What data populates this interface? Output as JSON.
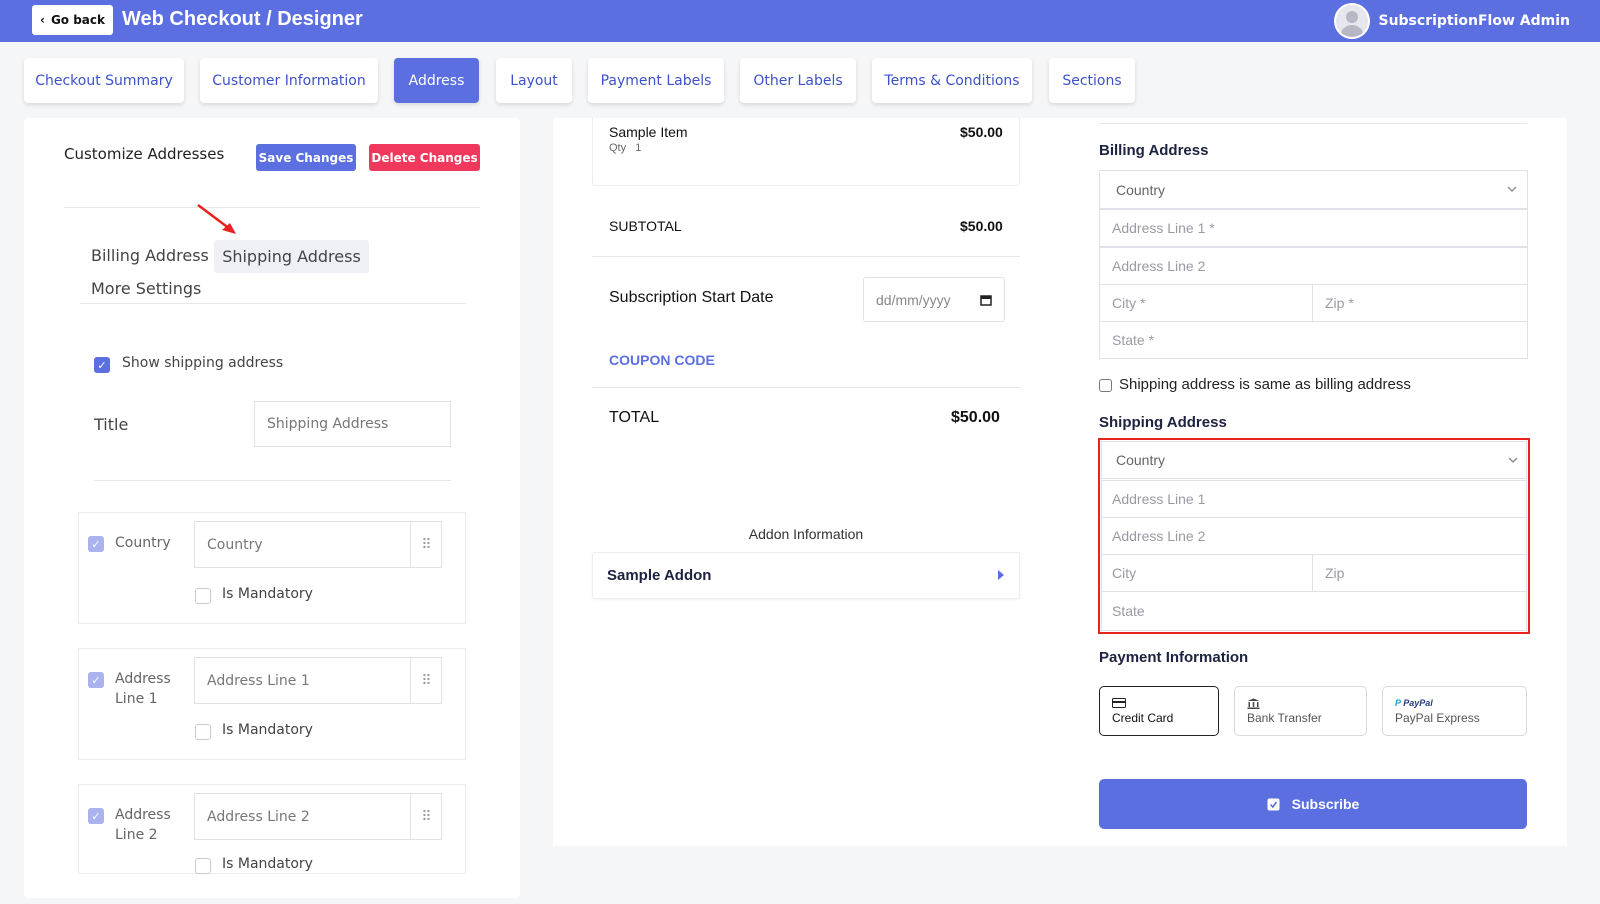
{
  "header": {
    "go_back": "Go back",
    "title": "Web Checkout / Designer",
    "user_name": "SubscriptionFlow Admin"
  },
  "tabs": [
    {
      "label": "Checkout Summary"
    },
    {
      "label": "Customer Information"
    },
    {
      "label": "Address"
    },
    {
      "label": "Layout"
    },
    {
      "label": "Payment Labels"
    },
    {
      "label": "Other Labels"
    },
    {
      "label": "Terms & Conditions"
    },
    {
      "label": "Sections"
    }
  ],
  "left": {
    "heading": "Customize Addresses",
    "save": "Save Changes",
    "delete": "Delete Changes",
    "subtabs": [
      "Billing Address",
      "Shipping Address",
      "More Settings"
    ],
    "show_shipping": "Show shipping address",
    "title_label": "Title",
    "title_value": "Shipping Address",
    "fields": [
      {
        "name": "Country",
        "value": "Country",
        "mandatory": "Is Mandatory"
      },
      {
        "name": "Address Line 1",
        "value": "Address Line 1",
        "mandatory": "Is Mandatory"
      },
      {
        "name": "Address Line 2",
        "value": "Address Line 2",
        "mandatory": "Is Mandatory"
      }
    ]
  },
  "mid": {
    "item_name": "Sample Item",
    "item_qty": "Qty   1",
    "item_price": "$50.00",
    "subtotal_label": "SUBTOTAL",
    "subtotal_value": "$50.00",
    "start_date_label": "Subscription Start Date",
    "date_placeholder": "dd/mm/yyyy",
    "coupon": "COUPON CODE",
    "total_label": "TOTAL",
    "total_value": "$50.00",
    "addon_info": "Addon Information",
    "addon_name": "Sample Addon"
  },
  "right": {
    "billing_title": "Billing Address",
    "billing": {
      "country": "Country",
      "line1": "Address Line 1 *",
      "line2": "Address Line 2",
      "city": "City *",
      "zip": "Zip *",
      "state": "State *"
    },
    "same_as": "Shipping address is same as billing address",
    "shipping_title": "Shipping Address",
    "shipping": {
      "country": "Country",
      "line1": "Address Line 1",
      "line2": "Address Line 2",
      "city": "City",
      "zip": "Zip",
      "state": "State"
    },
    "payment_title": "Payment Information",
    "payment_options": [
      "Credit Card",
      "Bank Transfer",
      "PayPal Express"
    ],
    "paypal_logo": "PayPal",
    "subscribe": "Subscribe"
  },
  "colors": {
    "accent": "#5b6fe0",
    "danger": "#f0375c",
    "highlight": "#e8231f"
  },
  "icons": [
    "chevron-left-icon",
    "user-avatar-icon",
    "calendar-icon",
    "caret-right-icon",
    "chevron-down-icon",
    "drag-handle-icon",
    "credit-card-icon",
    "bank-icon",
    "paypal-icon",
    "subscribe-icon",
    "arrow-annotation-icon"
  ]
}
